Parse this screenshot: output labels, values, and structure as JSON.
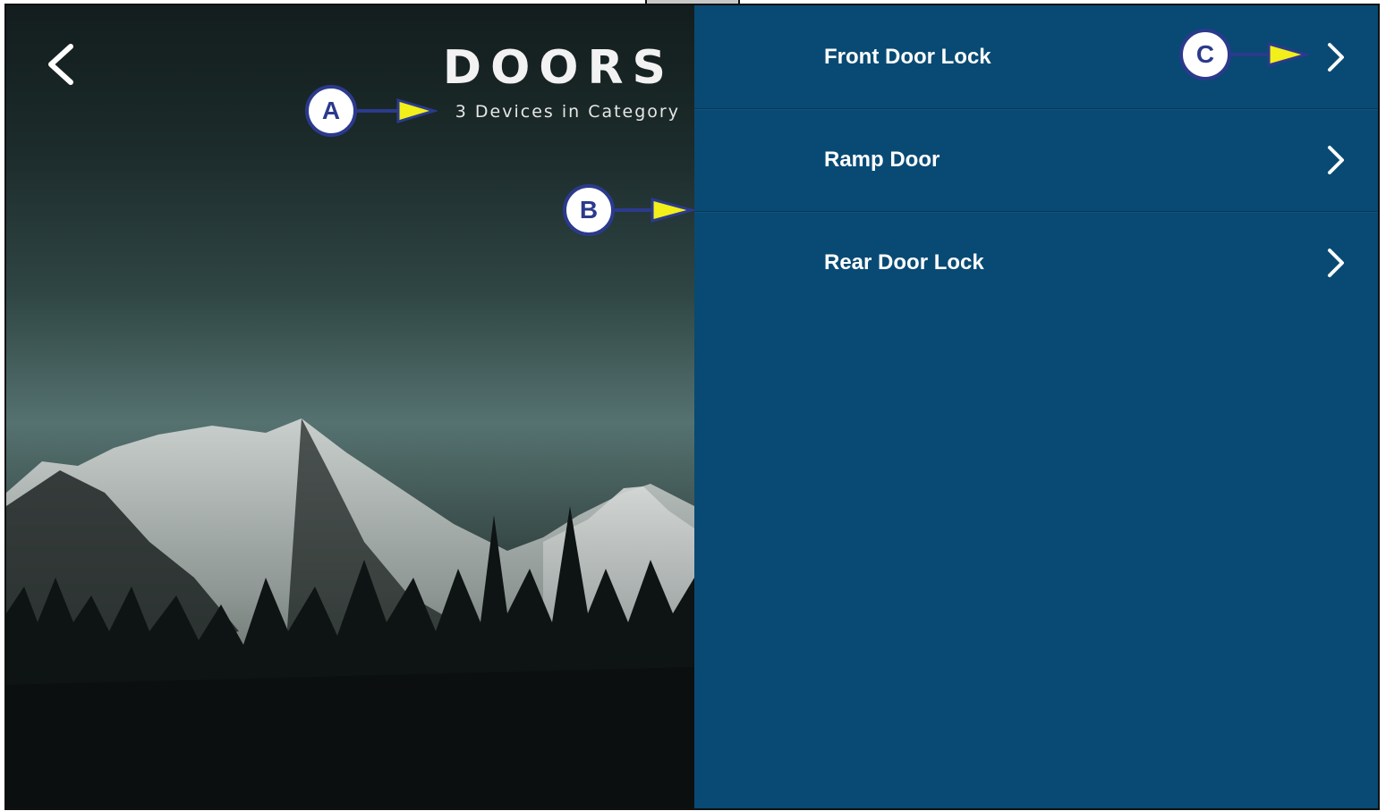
{
  "header": {
    "title": "DOORS",
    "subtitle": "3 Devices in Category"
  },
  "devices": [
    {
      "label": "Front Door Lock"
    },
    {
      "label": "Ramp Door"
    },
    {
      "label": "Rear Door Lock"
    }
  ],
  "callouts": {
    "a": "A",
    "b": "B",
    "c": "C"
  },
  "icons": {
    "back": "chevron-left-icon",
    "row": "chevron-right-icon"
  },
  "colors": {
    "list_background": "#084a74",
    "callout_border": "#2b3a8c",
    "callout_arrow": "#f2ef1a"
  }
}
